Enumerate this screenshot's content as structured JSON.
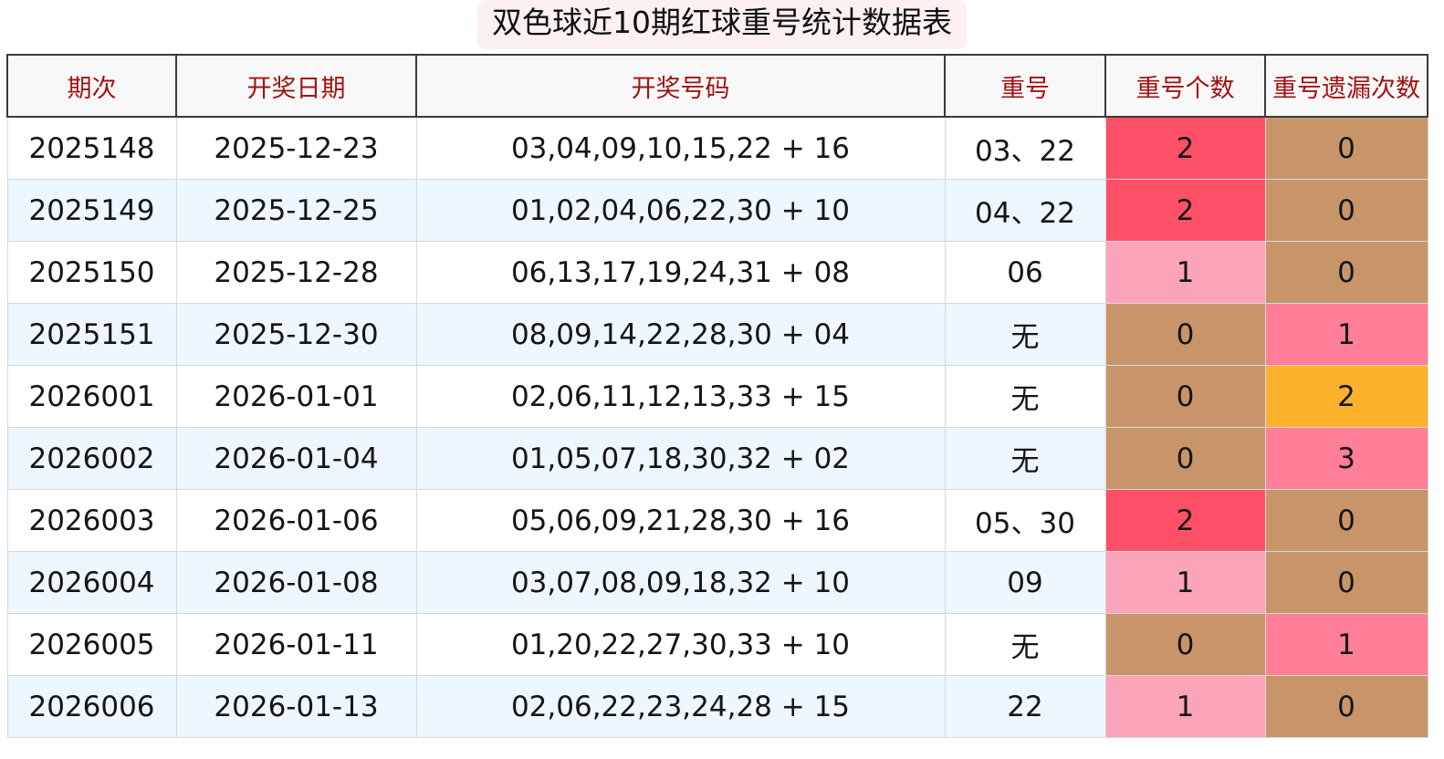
{
  "title": "双色球近10期红球重号统计数据表",
  "headers": {
    "period": "期次",
    "date": "开奖日期",
    "numbers": "开奖号码",
    "repeat": "重号",
    "repeat_count": "重号个数",
    "miss_count": "重号遗漏次数"
  },
  "colors": {
    "header_text": "#a11212",
    "count_2": "#ff5068",
    "count_1": "#fca4ba",
    "count_0": "#c8956a",
    "miss_0": "#c8956a",
    "miss_1": "#ff7e98",
    "miss_2": "#fdb22e",
    "miss_3": "#ff7e98"
  },
  "rows": [
    {
      "period": "2025148",
      "date": "2025-12-23",
      "numbers": "03,04,09,10,15,22 + 16",
      "repeat": "03、22",
      "repeat_count": "2",
      "miss_count": "0"
    },
    {
      "period": "2025149",
      "date": "2025-12-25",
      "numbers": "01,02,04,06,22,30 + 10",
      "repeat": "04、22",
      "repeat_count": "2",
      "miss_count": "0"
    },
    {
      "period": "2025150",
      "date": "2025-12-28",
      "numbers": "06,13,17,19,24,31 + 08",
      "repeat": "06",
      "repeat_count": "1",
      "miss_count": "0"
    },
    {
      "period": "2025151",
      "date": "2025-12-30",
      "numbers": "08,09,14,22,28,30 + 04",
      "repeat": "无",
      "repeat_count": "0",
      "miss_count": "1"
    },
    {
      "period": "2026001",
      "date": "2026-01-01",
      "numbers": "02,06,11,12,13,33 + 15",
      "repeat": "无",
      "repeat_count": "0",
      "miss_count": "2"
    },
    {
      "period": "2026002",
      "date": "2026-01-04",
      "numbers": "01,05,07,18,30,32 + 02",
      "repeat": "无",
      "repeat_count": "0",
      "miss_count": "3"
    },
    {
      "period": "2026003",
      "date": "2026-01-06",
      "numbers": "05,06,09,21,28,30 + 16",
      "repeat": "05、30",
      "repeat_count": "2",
      "miss_count": "0"
    },
    {
      "period": "2026004",
      "date": "2026-01-08",
      "numbers": "03,07,08,09,18,32 + 10",
      "repeat": "09",
      "repeat_count": "1",
      "miss_count": "0"
    },
    {
      "period": "2026005",
      "date": "2026-01-11",
      "numbers": "01,20,22,27,30,33 + 10",
      "repeat": "无",
      "repeat_count": "0",
      "miss_count": "1"
    },
    {
      "period": "2026006",
      "date": "2026-01-13",
      "numbers": "02,06,22,23,24,28 + 15",
      "repeat": "22",
      "repeat_count": "1",
      "miss_count": "0"
    }
  ]
}
